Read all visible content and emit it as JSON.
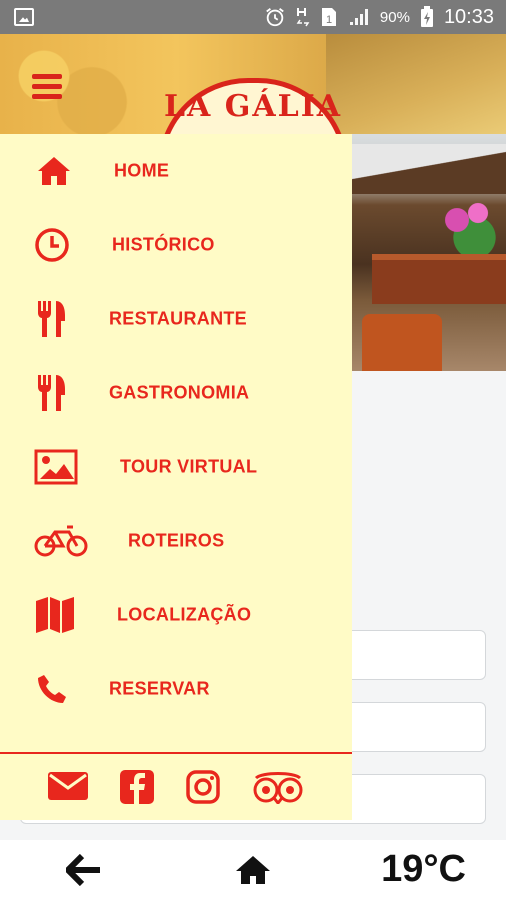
{
  "status_bar": {
    "battery_percent": "90%",
    "time": "10:33",
    "icons": [
      "image-icon",
      "alarm-icon",
      "network-h-icon",
      "sim-icon",
      "signal-icon",
      "battery-charging-icon"
    ]
  },
  "header": {
    "logo_text": "LA GÁLIA",
    "menu_icon": "hamburger-icon"
  },
  "drawer": {
    "items": [
      {
        "label": "HOME",
        "icon": "home-icon"
      },
      {
        "label": "HISTÓRICO",
        "icon": "clock-icon"
      },
      {
        "label": "RESTAURANTE",
        "icon": "utensils-icon"
      },
      {
        "label": "GASTRONOMIA",
        "icon": "utensils-icon"
      },
      {
        "label": "TOUR VIRTUAL",
        "icon": "image-icon"
      },
      {
        "label": "ROTEIROS",
        "icon": "bicycle-icon"
      },
      {
        "label": "LOCALIZAÇÃO",
        "icon": "map-icon"
      },
      {
        "label": "RESERVAR",
        "icon": "phone-icon"
      }
    ],
    "social": [
      "envelope-icon",
      "facebook-icon",
      "instagram-icon",
      "tripadvisor-icon"
    ]
  },
  "bottom_nav": {
    "back_icon": "arrow-left-icon",
    "home_icon": "home-icon",
    "temperature": "19°C"
  },
  "colors": {
    "accent": "#e8271d",
    "drawer_bg": "#fffbc6"
  }
}
